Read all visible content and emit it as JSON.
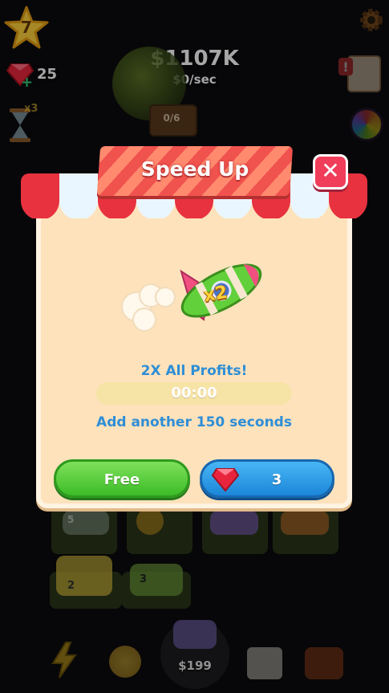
{
  "hud": {
    "level": "7",
    "gems": "25",
    "money": "$1107K",
    "rate": "$0/sec",
    "boost_badge": "x3"
  },
  "board": {
    "progress_sign": "0/6",
    "car_levels": [
      "5",
      "2",
      "3"
    ],
    "buy_price": "$199"
  },
  "popup": {
    "title": "Speed Up",
    "multiplier": "x2",
    "description": "2X All Profits!",
    "timer": "00:00",
    "extra": "Add another 150 seconds",
    "free_label": "Free",
    "gem_cost": "3"
  },
  "colors": {
    "title_red": "#f0524e",
    "accent_blue": "#2f8ed6",
    "free_green": "#3cbc28",
    "gem_blue": "#1c86d9",
    "panel": "#fde2bc"
  },
  "icons": {
    "level": "star-icon",
    "gems": "ruby-icon",
    "settings": "gear-icon",
    "close": "close-icon",
    "boost": "rocket-icon",
    "quests": "quest-board-icon",
    "spin": "color-wheel-icon",
    "hourglass": "hourglass-icon",
    "bolt": "lightning-icon",
    "coin": "coin-icon",
    "shop": "shop-icon",
    "chest": "chest-icon"
  }
}
